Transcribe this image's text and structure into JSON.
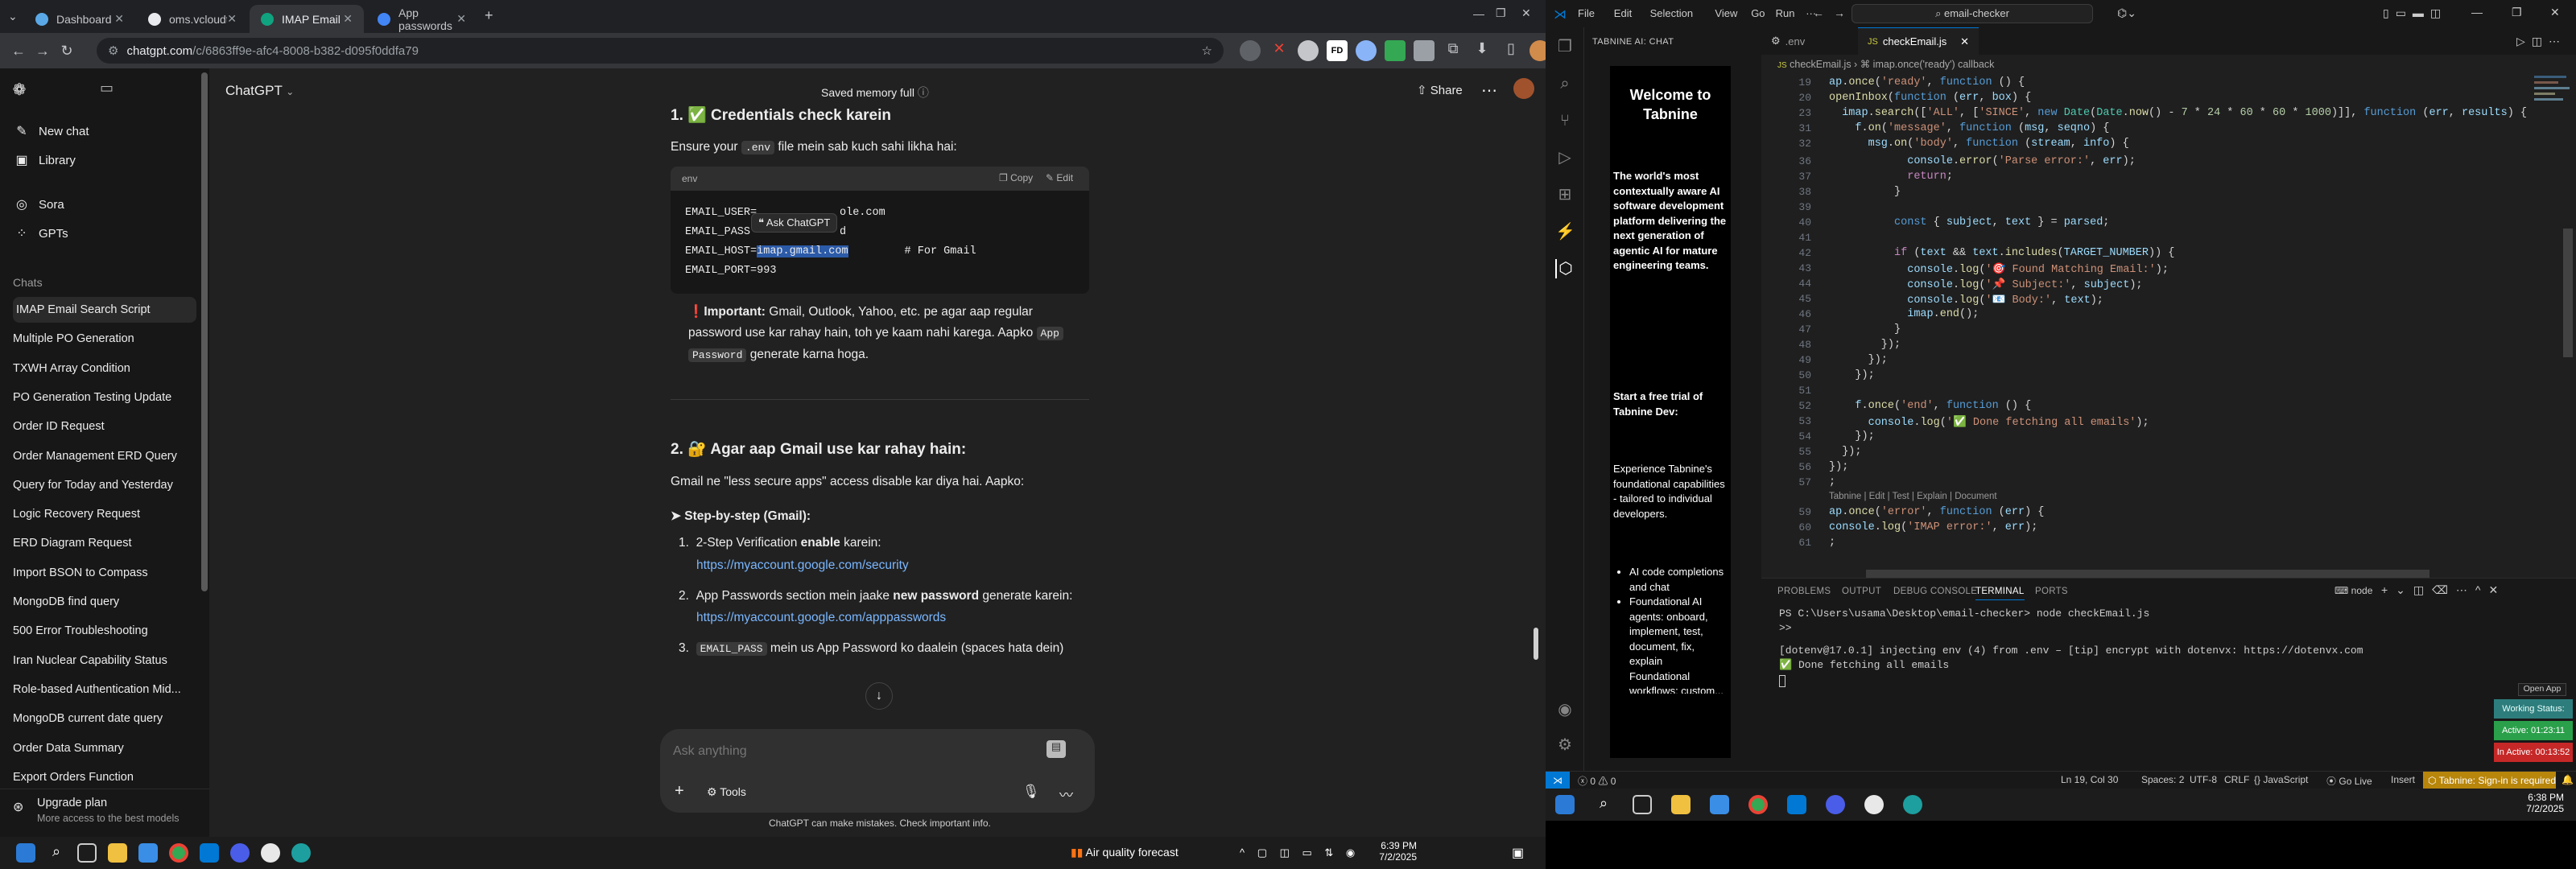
{
  "browser": {
    "tabs": [
      {
        "title": "Dashboard",
        "color": "#5aa9e6"
      },
      {
        "title": "oms.vcloudtech.org/dashboard",
        "color": "#e8eaed"
      },
      {
        "title": "IMAP Email Search Script",
        "color": "#10a37f"
      },
      {
        "title": "App passwords",
        "color": "#4285f4"
      }
    ],
    "url_host": "chatgpt.com",
    "url_path": "/c/6863ff9e-afc4-8008-b382-d095f0ddfa79"
  },
  "chatgpt": {
    "model": "ChatGPT",
    "banner": "Saved memory full",
    "share": "Share",
    "sidebar": {
      "new_chat": "New chat",
      "library": "Library",
      "sora": "Sora",
      "gpts": "GPTs",
      "chats_heading": "Chats",
      "chats": [
        "IMAP Email Search Script",
        "Multiple PO Generation",
        "TXWH Array Condition",
        "PO Generation Testing Update",
        "Order ID Request",
        "Order Management ERD Query",
        "Query for Today and Yesterday",
        "Logic Recovery Request",
        "ERD Diagram Request",
        "Import BSON to Compass",
        "MongoDB find query",
        "500 Error Troubleshooting",
        "Iran Nuclear Capability Status",
        "Role-based Authentication Mid...",
        "MongoDB current date query",
        "Order Data Summary",
        "Export Orders Function"
      ],
      "upgrade_title": "Upgrade plan",
      "upgrade_sub": "More access to the best models"
    },
    "heading1": "1. ✅ Credentials check karein",
    "para1_a": "Ensure your",
    "para1_code": ".env",
    "para1_b": "file mein sab kuch sahi likha hai:",
    "codeblock": {
      "lang": "env",
      "copy": "Copy",
      "edit": "Edit",
      "line1": "EMAIL_USER=",
      "line1_tail": "ole.com",
      "line2": "EMAIL_PASS",
      "line2_tail": "d",
      "line3_a": "EMAIL_HOST=",
      "line3_sel": "imap.gmail.com",
      "line3_c": "# For Gmail",
      "line4": "EMAIL_PORT=993",
      "tooltip": "Ask ChatGPT"
    },
    "important_label": "Important:",
    "important_text": "Gmail, Outlook, Yahoo, etc. pe agar aap regular password use kar rahay hain, toh ye kaam nahi karega. Aapko",
    "important_code1": "App",
    "important_code2": "Password",
    "important_tail": "generate karna hoga.",
    "heading2": "2. 🔐 Agar aap Gmail use kar rahay hain:",
    "para2": "Gmail ne \"less secure apps\" access disable kar diya hai. Aapko:",
    "step_heading": "➤ Step-by-step (Gmail):",
    "steps": [
      {
        "num": "1.",
        "a": "2-Step Verification ",
        "b": "enable",
        "c": " karein:",
        "link": "https://myaccount.google.com/security"
      },
      {
        "num": "2.",
        "a": "App Passwords section mein jaake ",
        "b": "new password",
        "c": " generate karein:",
        "link": "https://myaccount.google.com/apppasswords"
      },
      {
        "num": "3.",
        "code": "EMAIL_PASS",
        "c": " mein us App Password ko daalein (spaces hata dein)"
      }
    ],
    "input_placeholder": "Ask anything",
    "tools": "Tools",
    "disclaimer": "ChatGPT can make mistakes. Check important info."
  },
  "taskbar_left": {
    "weather": "Air quality forecast",
    "time": "6:39 PM",
    "date": "7/2/2025"
  },
  "vscode": {
    "menu": [
      "File",
      "Edit",
      "Selection",
      "View",
      "Go",
      "Run",
      "···"
    ],
    "search": "email-checker",
    "side_title": "TABNINE AI: CHAT",
    "tabnine": {
      "welcome": "Welcome to Tabnine",
      "body1": "The world's most contextually aware AI software development platform delivering the next generation of agentic AI for mature engineering teams.",
      "body2": "Start a free trial of Tabnine Dev:",
      "body3": "Experience Tabnine's foundational capabilities - tailored to individual developers.",
      "bullets": [
        "AI code completions and chat",
        "Foundational AI agents: onboard, implement, test, document, fix, explain",
        "Foundational workflows: custom..."
      ]
    },
    "tabs": [
      ".env",
      "checkEmail.js"
    ],
    "breadcrumb_file": "checkEmail.js",
    "breadcrumb_fn": "imap.once('ready') callback",
    "codelens": "Tabnine | Edit | Test | Explain | Document",
    "terminal_tabs": [
      "PROBLEMS",
      "OUTPUT",
      "DEBUG CONSOLE",
      "TERMINAL",
      "PORTS"
    ],
    "terminal_shell": "node",
    "terminal": [
      "PS C:\\Users\\usama\\Desktop\\email-checker> node checkEmail.js",
      ">>",
      "[dotenv@17.0.1] injecting env (4) from .env – [tip] encrypt with dotenvx: https://dotenvx.com",
      "✅ Done fetching all emails"
    ],
    "status": {
      "errors": "0",
      "warnings": "0",
      "position": "Ln 19, Col 30",
      "spaces": "Spaces: 2",
      "encoding": "UTF-8",
      "eol": "CRLF",
      "language": "JavaScript",
      "golive": "Go Live",
      "insert": "Insert",
      "tabnine": "Tabnine: Sign-in is required"
    },
    "widget": {
      "open_app": "Open App",
      "working": "Working Status: Active",
      "active": "Active: 01:23:11",
      "inactive": "In Active: 00:13:52"
    },
    "time": "6:38 PM",
    "date": "7/2/2025"
  }
}
